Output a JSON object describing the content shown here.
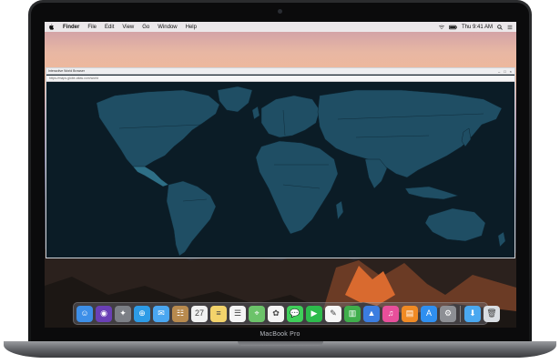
{
  "menubar": {
    "items": [
      "Finder",
      "File",
      "Edit",
      "View",
      "Go",
      "Window",
      "Help"
    ],
    "clock": "Thu 9:41 AM"
  },
  "window": {
    "title": "Interactive World Browser",
    "url": "https://maps.globe-atlas.com/world"
  },
  "map": {
    "ocean_color": "#0b1c26",
    "land_color": "#1f4e64",
    "border_color": "#0d2633",
    "highlight_color": "#2e6f86"
  },
  "dock": {
    "apps": [
      {
        "name": "Finder",
        "color": "#3d8fe8",
        "glyph": "☺"
      },
      {
        "name": "Siri",
        "color": "#6a3fb5",
        "glyph": "◉"
      },
      {
        "name": "Launchpad",
        "color": "#7c7f86",
        "glyph": "✦"
      },
      {
        "name": "Safari",
        "color": "#2d9be6",
        "glyph": "⊕"
      },
      {
        "name": "Mail",
        "color": "#4aa6f0",
        "glyph": "✉"
      },
      {
        "name": "Contacts",
        "color": "#b88a4e",
        "glyph": "☷"
      },
      {
        "name": "Calendar",
        "color": "#f2f2f2",
        "glyph": "27"
      },
      {
        "name": "Notes",
        "color": "#f3d36b",
        "glyph": "≡"
      },
      {
        "name": "Reminders",
        "color": "#f5f5f5",
        "glyph": "☰"
      },
      {
        "name": "Maps",
        "color": "#6cc36a",
        "glyph": "⌖"
      },
      {
        "name": "Photos",
        "color": "#f4f4f4",
        "glyph": "✿"
      },
      {
        "name": "Messages",
        "color": "#3fcf5a",
        "glyph": "💬"
      },
      {
        "name": "FaceTime",
        "color": "#2dbb4c",
        "glyph": "▶"
      },
      {
        "name": "Pages",
        "color": "#f7f7f7",
        "glyph": "✎"
      },
      {
        "name": "Numbers",
        "color": "#3fae4b",
        "glyph": "▥"
      },
      {
        "name": "Keynote",
        "color": "#3b7de0",
        "glyph": "▲"
      },
      {
        "name": "iTunes",
        "color": "#e84f9b",
        "glyph": "♫"
      },
      {
        "name": "iBooks",
        "color": "#f08a24",
        "glyph": "▤"
      },
      {
        "name": "App Store",
        "color": "#2f8ff0",
        "glyph": "A"
      },
      {
        "name": "System Preferences",
        "color": "#8d8f94",
        "glyph": "⚙"
      },
      {
        "name": "Downloads",
        "color": "#4aa8f0",
        "glyph": "⬇"
      },
      {
        "name": "Trash",
        "color": "#d9dde2",
        "glyph": "🗑"
      }
    ]
  },
  "laptop": {
    "brand": "MacBook Pro"
  }
}
